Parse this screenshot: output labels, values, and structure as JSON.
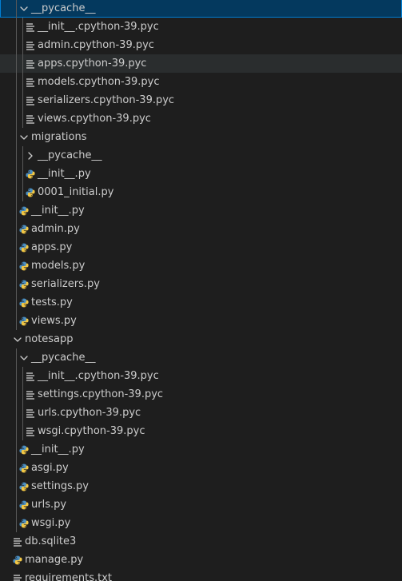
{
  "explorer": {
    "rows": [
      {
        "label": "__pycache__",
        "icon": "chevron-down-icon",
        "kind": "folder-open",
        "depth": 1,
        "state": "selected"
      },
      {
        "label": "__init__.cpython-39.pyc",
        "icon": "lines-file-icon",
        "kind": "file",
        "depth": 2
      },
      {
        "label": "admin.cpython-39.pyc",
        "icon": "lines-file-icon",
        "kind": "file",
        "depth": 2
      },
      {
        "label": "apps.cpython-39.pyc",
        "icon": "lines-file-icon",
        "kind": "file",
        "depth": 2,
        "state": "hover"
      },
      {
        "label": "models.cpython-39.pyc",
        "icon": "lines-file-icon",
        "kind": "file",
        "depth": 2
      },
      {
        "label": "serializers.cpython-39.pyc",
        "icon": "lines-file-icon",
        "kind": "file",
        "depth": 2
      },
      {
        "label": "views.cpython-39.pyc",
        "icon": "lines-file-icon",
        "kind": "file",
        "depth": 2
      },
      {
        "label": "migrations",
        "icon": "chevron-down-icon",
        "kind": "folder-open",
        "depth": 1
      },
      {
        "label": "__pycache__",
        "icon": "chevron-right-icon",
        "kind": "folder-closed",
        "depth": 2
      },
      {
        "label": "__init__.py",
        "icon": "python-icon",
        "kind": "file",
        "depth": 2
      },
      {
        "label": "0001_initial.py",
        "icon": "python-icon",
        "kind": "file",
        "depth": 2
      },
      {
        "label": "__init__.py",
        "icon": "python-icon",
        "kind": "file",
        "depth": 1
      },
      {
        "label": "admin.py",
        "icon": "python-icon",
        "kind": "file",
        "depth": 1
      },
      {
        "label": "apps.py",
        "icon": "python-icon",
        "kind": "file",
        "depth": 1
      },
      {
        "label": "models.py",
        "icon": "python-icon",
        "kind": "file",
        "depth": 1
      },
      {
        "label": "serializers.py",
        "icon": "python-icon",
        "kind": "file",
        "depth": 1
      },
      {
        "label": "tests.py",
        "icon": "python-icon",
        "kind": "file",
        "depth": 1
      },
      {
        "label": "views.py",
        "icon": "python-icon",
        "kind": "file",
        "depth": 1
      },
      {
        "label": "notesapp",
        "icon": "chevron-down-icon",
        "kind": "folder-open",
        "depth": 0
      },
      {
        "label": "__pycache__",
        "icon": "chevron-down-icon",
        "kind": "folder-open",
        "depth": 1
      },
      {
        "label": "__init__.cpython-39.pyc",
        "icon": "lines-file-icon",
        "kind": "file",
        "depth": 2
      },
      {
        "label": "settings.cpython-39.pyc",
        "icon": "lines-file-icon",
        "kind": "file",
        "depth": 2
      },
      {
        "label": "urls.cpython-39.pyc",
        "icon": "lines-file-icon",
        "kind": "file",
        "depth": 2
      },
      {
        "label": "wsgi.cpython-39.pyc",
        "icon": "lines-file-icon",
        "kind": "file",
        "depth": 2
      },
      {
        "label": "__init__.py",
        "icon": "python-icon",
        "kind": "file",
        "depth": 1
      },
      {
        "label": "asgi.py",
        "icon": "python-icon",
        "kind": "file",
        "depth": 1
      },
      {
        "label": "settings.py",
        "icon": "python-icon",
        "kind": "file",
        "depth": 1
      },
      {
        "label": "urls.py",
        "icon": "python-icon",
        "kind": "file",
        "depth": 1
      },
      {
        "label": "wsgi.py",
        "icon": "python-icon",
        "kind": "file",
        "depth": 1
      },
      {
        "label": "db.sqlite3",
        "icon": "lines-file-icon",
        "kind": "file",
        "depth": 0
      },
      {
        "label": "manage.py",
        "icon": "python-icon",
        "kind": "file",
        "depth": 0
      },
      {
        "label": "requirements.txt",
        "icon": "lines-file-icon",
        "kind": "file",
        "depth": 0
      }
    ]
  },
  "colors": {
    "background": "#1e1e1e",
    "text": "#cccccc",
    "selection": "#04395e",
    "selection_border": "#007fd4",
    "hover": "#2a2d2e",
    "indent_guide": "#585858",
    "python_blue": "#4a8ec2",
    "python_yellow": "#f2c744",
    "file_lines": "#c5c5c5"
  }
}
